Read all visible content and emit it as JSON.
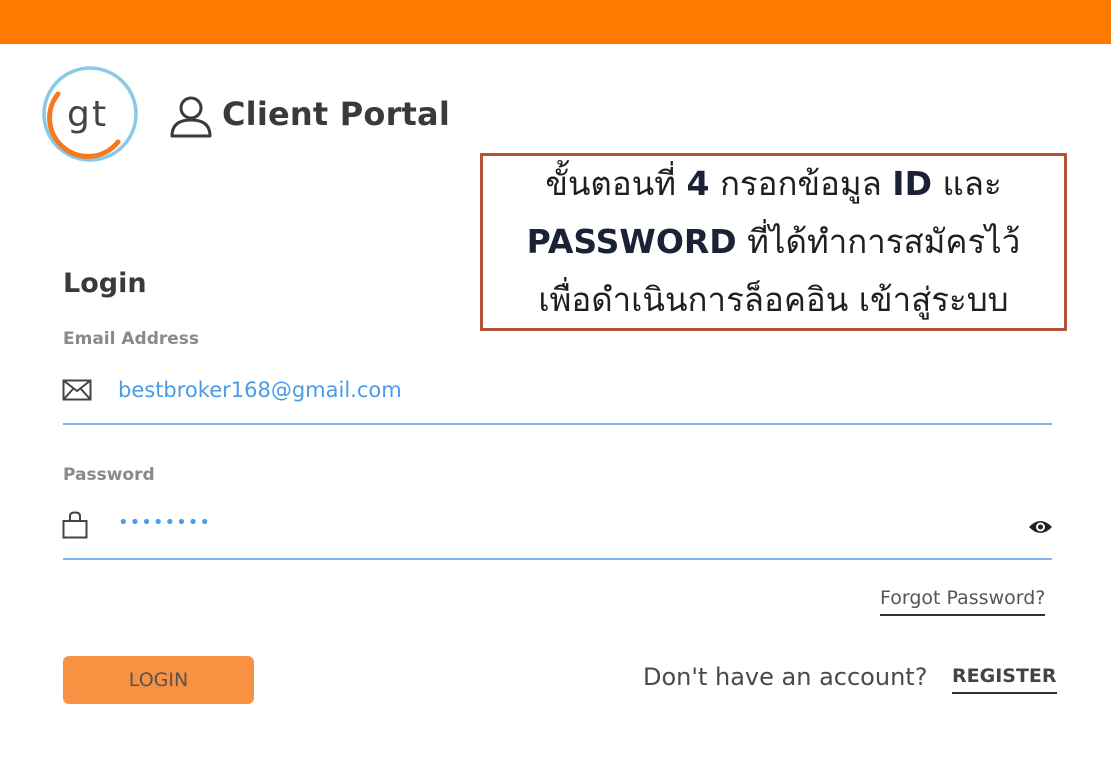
{
  "header": {
    "logo_icon": "gt-logo",
    "user_icon": "user-icon",
    "portal_title": "Client Portal"
  },
  "callout": {
    "line1_a": "ขั้นตอนที่ ",
    "line1_b": "4",
    "line1_c": " กรอกข้อมูล ",
    "line1_d": "ID",
    "line1_e": " และ",
    "line2_a": "PASSWORD",
    "line2_b": " ที่ได้ทำการสมัครไว้",
    "line3": "เพื่อดำเนินการล็อคอิน เข้าสู่ระบบ"
  },
  "form": {
    "heading": "Login",
    "email_label": "Email Address",
    "email_value": "bestbroker168@gmail.com",
    "password_label": "Password",
    "password_value": "••••••••",
    "forgot_link": "Forgot Password?",
    "login_button": "LOGIN",
    "no_account_text": "Don't have an account?",
    "register_link": "REGISTER"
  },
  "colors": {
    "top_bar": "#ff7b00",
    "login_button": "#f99142",
    "input_text": "#4a9be8",
    "underline": "#7eb6ea",
    "callout_border": "#b5533a"
  }
}
